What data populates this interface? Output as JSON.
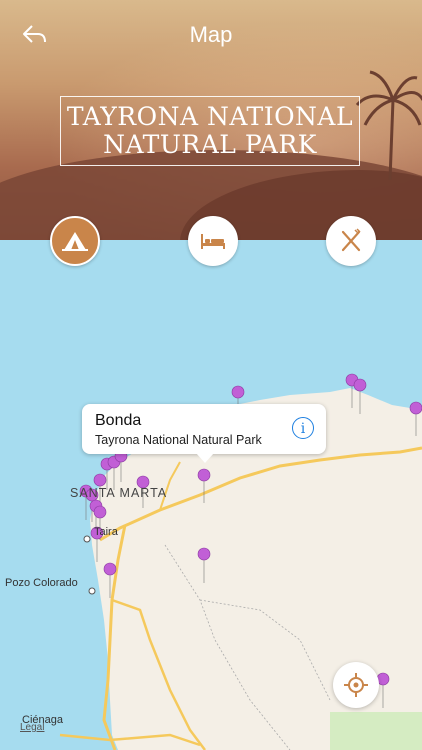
{
  "header": {
    "title": "Map",
    "back_icon": "back-arrow-icon",
    "park_name": "TAYRONA NATIONAL NATURAL PARK"
  },
  "categories": [
    {
      "icon": "camping-tent-icon",
      "active": true
    },
    {
      "icon": "hotel-bed-icon",
      "active": false
    },
    {
      "icon": "restaurant-fork-knife-icon",
      "active": false
    }
  ],
  "map": {
    "callout": {
      "title": "Bonda",
      "subtitle": "Tayrona National Natural Park",
      "info_icon": "info-icon",
      "info_glyph": "i"
    },
    "labels": {
      "santa_marta": "SANTA MARTA",
      "taira": "Taira",
      "pozo_colorado": "Pozo Colorado",
      "cienaga": "Ciénaga",
      "legal": "Legal"
    },
    "location_button_icon": "locate-crosshair-icon"
  },
  "colors": {
    "accent": "#c9854a",
    "pin": "#c15fd6",
    "water": "#a6dcef",
    "land": "#f4efe6",
    "road": "#f5c95c"
  }
}
